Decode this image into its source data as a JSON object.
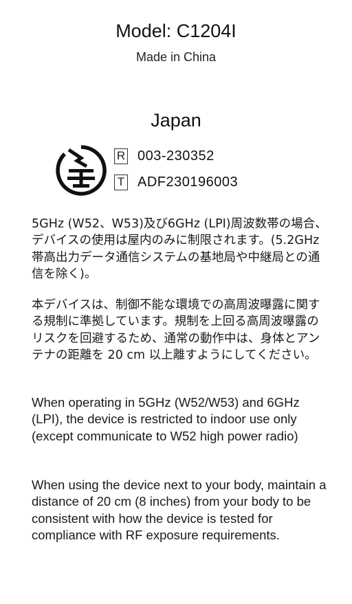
{
  "header": {
    "model": "Model: C1204I",
    "made_in": "Made in China"
  },
  "region": {
    "title": "Japan",
    "mark_icon": "japan-giteki-mark-icon",
    "certifications": [
      {
        "tag": "R",
        "value": "003-230352"
      },
      {
        "tag": "T",
        "value": "ADF230196003"
      }
    ]
  },
  "notices": {
    "ja_indoor": "5GHz (W52、W53)及び6GHz (LPI)周波数帯の場合、デバイスの使用は屋内のみに制限されます。(5.2GHz帯高出力データ通信システムの基地局や中継局との通信を除く)。",
    "ja_exposure": "本デバイスは、制御不能な環境での高周波曝露に関する規制に準拠しています。規制を上回る高周波曝露のリスクを回避するため、通常の動作中は、身体とアンテナの距離を 20 cm 以上離すようにしてください。",
    "en_indoor": "When operating in 5GHz (W52/W53) and 6GHz (LPI), the device is restricted to indoor use only (except communicate to W52 high power radio)",
    "en_exposure": "When using the device next to your body, maintain a distance of 20 cm (8 inches) from your body to be consistent with how the device is tested for compliance with RF exposure requirements."
  }
}
